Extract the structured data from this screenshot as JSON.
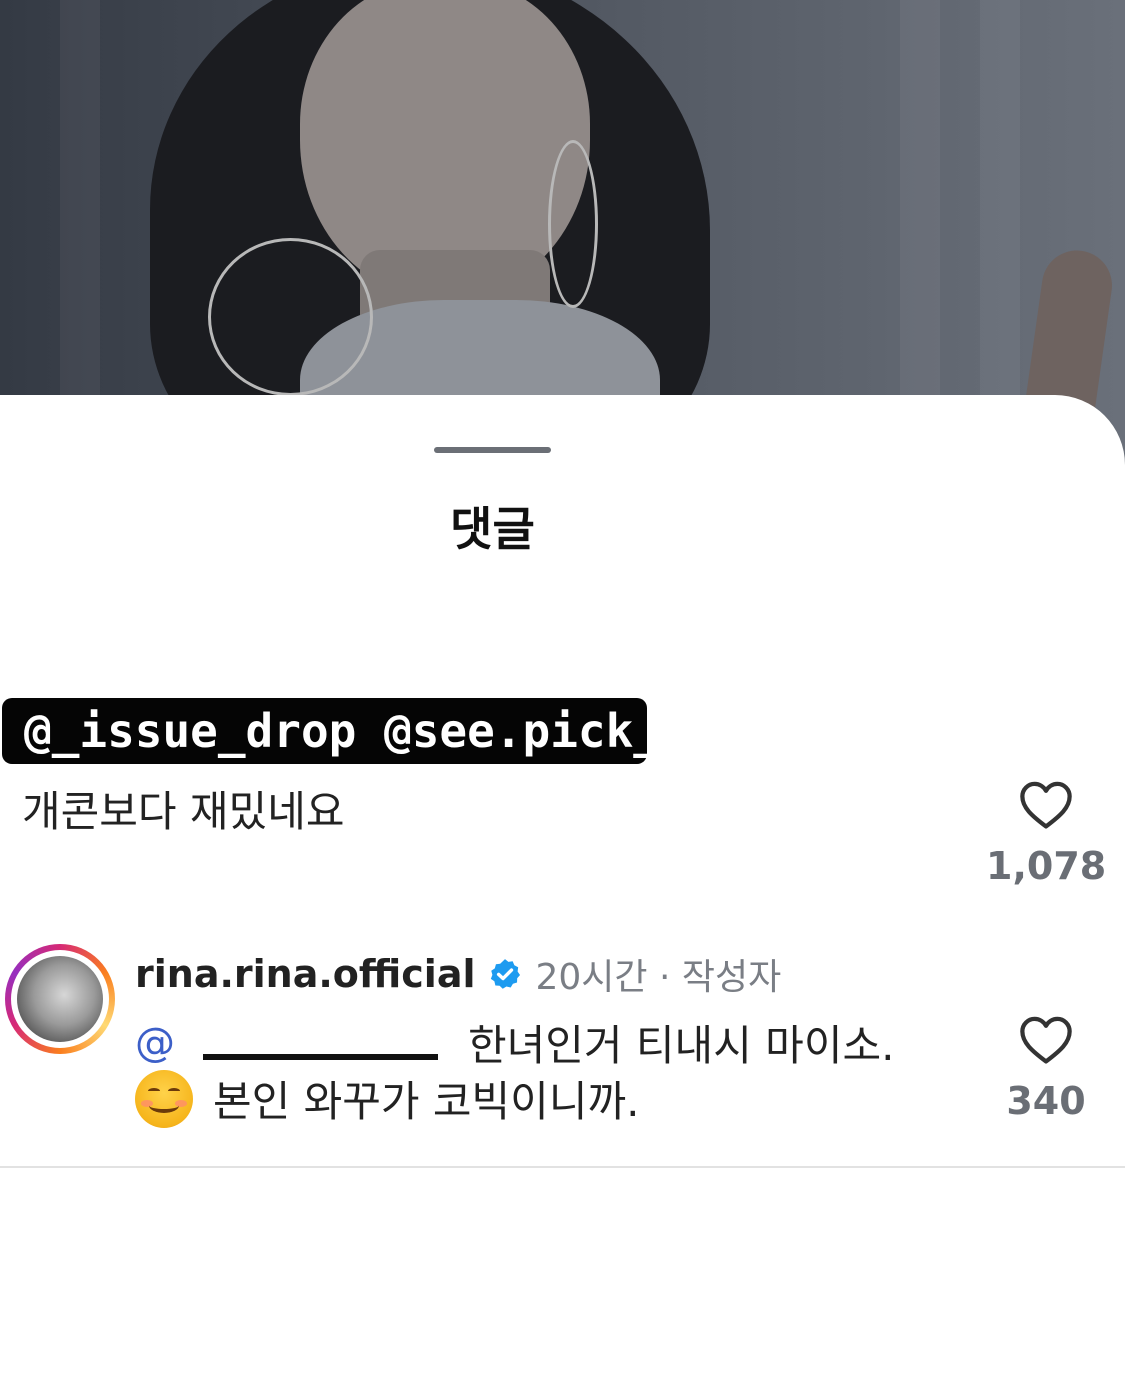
{
  "sheet": {
    "title": "댓글"
  },
  "overlay_tag": "@_issue_drop @see.pick_",
  "comments": [
    {
      "text": "개콘보다 재밌네요",
      "likes": "1,078"
    },
    {
      "username": "rina.rina.official",
      "meta": "20시간 · 작성자",
      "mention": "@",
      "text_line1": "한녀인거 티내시 마이소.",
      "text_line2": "본인 와꾸가 코빅이니까.",
      "likes": "340"
    }
  ],
  "colors": {
    "verified": "#1d9bf0",
    "mention": "#3c5fc8",
    "count": "#6a6e75"
  }
}
